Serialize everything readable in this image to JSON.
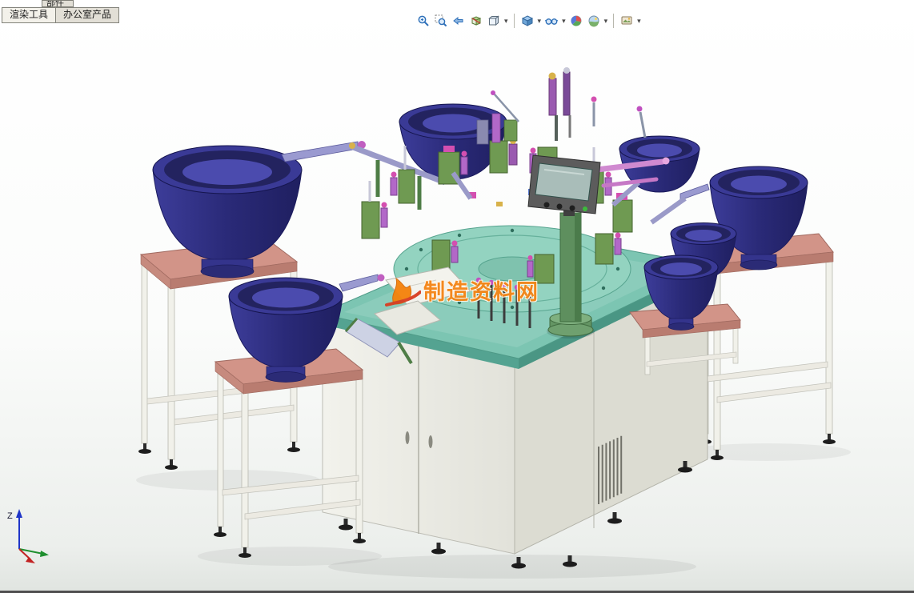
{
  "command_tabs": {
    "overflow_tab_label": "部件",
    "tabs": [
      {
        "label": "渲染工具",
        "active": true
      },
      {
        "label": "办公室产品",
        "active": false
      }
    ]
  },
  "heads_up_toolbar": {
    "icons": [
      {
        "name": "zoom-to-fit",
        "dropdown": false
      },
      {
        "name": "zoom-to-area",
        "dropdown": false
      },
      {
        "name": "previous-view",
        "dropdown": false
      },
      {
        "name": "section-view",
        "dropdown": false
      },
      {
        "name": "view-orientation",
        "dropdown": true
      },
      {
        "name": "display-style",
        "dropdown": true
      },
      {
        "name": "hide-show-items",
        "dropdown": true
      },
      {
        "name": "edit-appearance",
        "dropdown": false
      },
      {
        "name": "apply-scene",
        "dropdown": true
      },
      {
        "name": "view-settings",
        "dropdown": true
      }
    ]
  },
  "viewport": {
    "watermark_text": "制造资料网",
    "triad_axis_label": "Z"
  },
  "colors": {
    "bowl_navy": "#31318a",
    "table_teal": "#7cc5b2",
    "stand_salmon": "#d29488",
    "cabinet_white": "#ecece6",
    "watermark_orange": "#f58414"
  }
}
